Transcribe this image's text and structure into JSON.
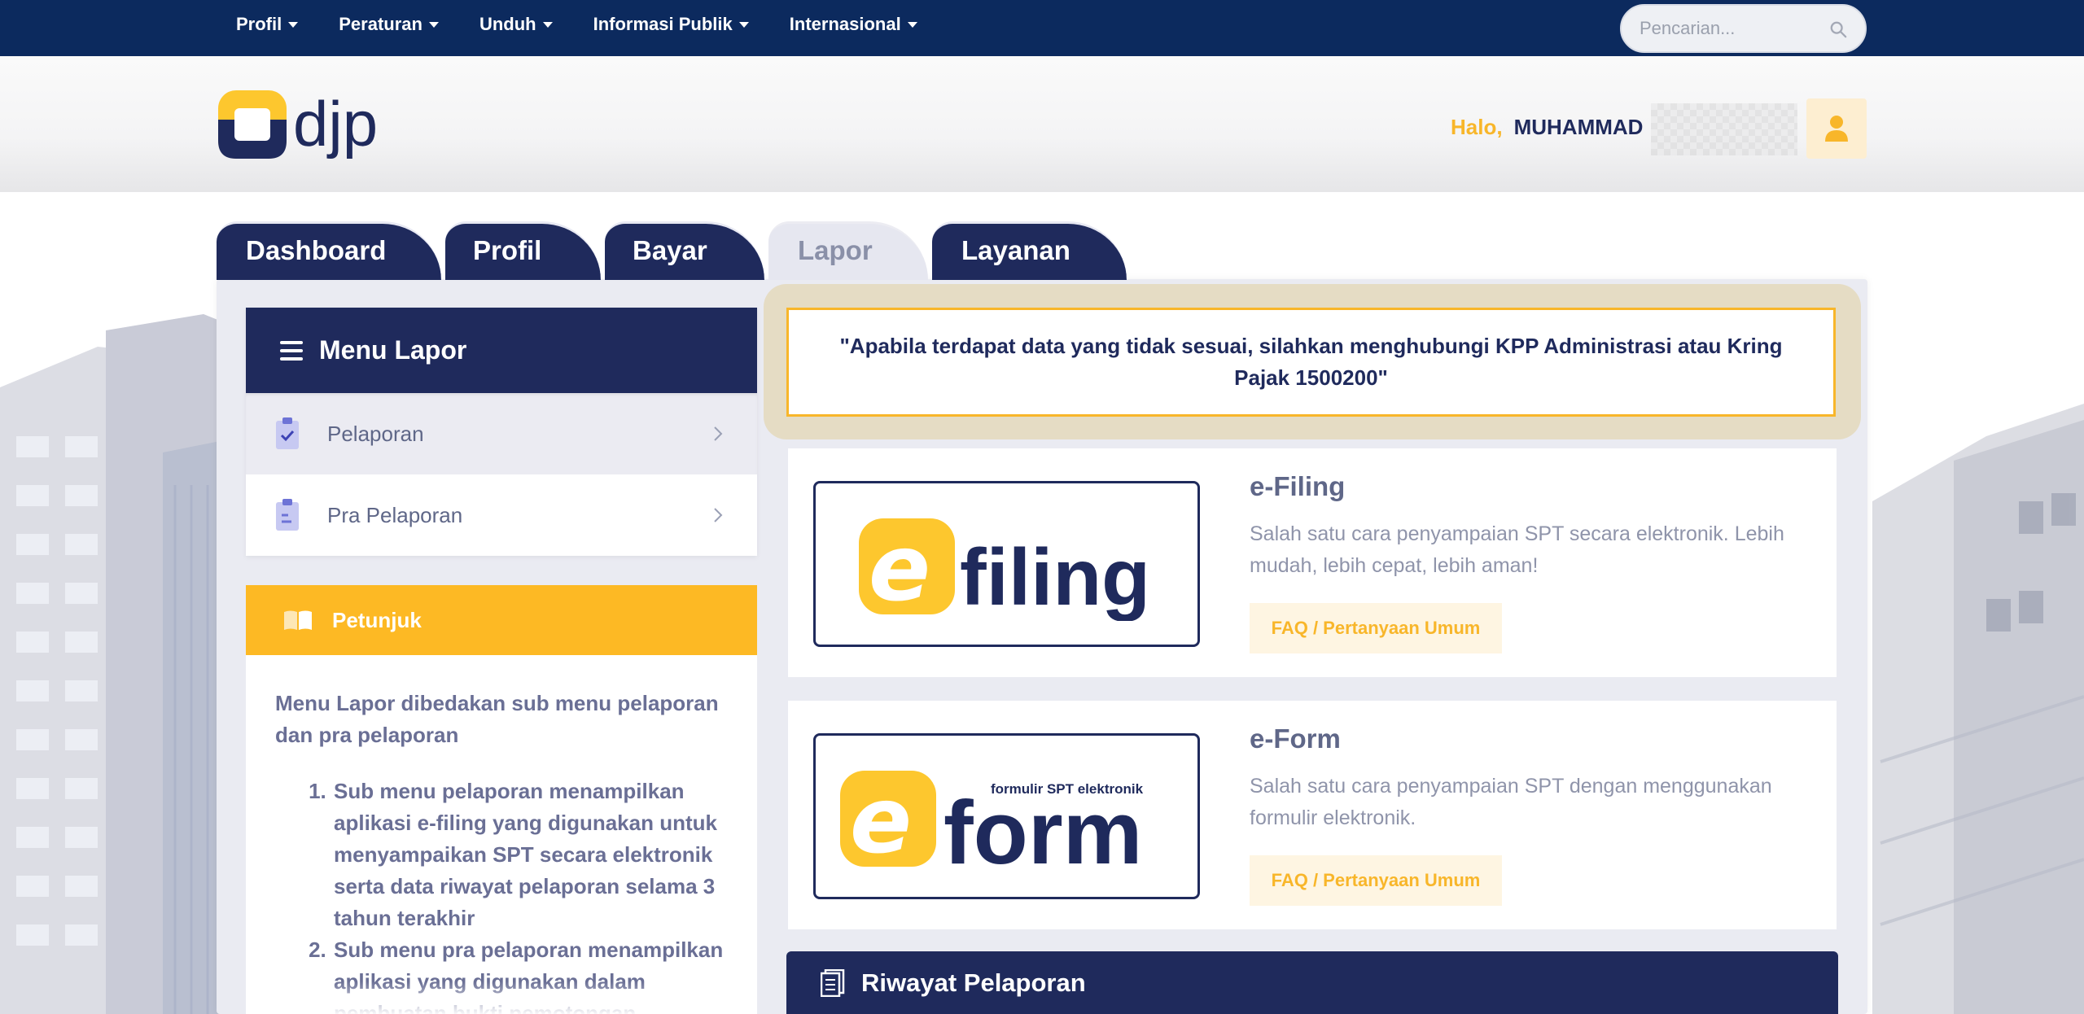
{
  "nav": {
    "items": [
      {
        "label": "Profil"
      },
      {
        "label": "Peraturan"
      },
      {
        "label": "Unduh"
      },
      {
        "label": "Informasi Publik"
      },
      {
        "label": "Internasional"
      }
    ],
    "search_placeholder": "Pencarian..."
  },
  "header": {
    "greeting": "Halo,",
    "user_name": "MUHAMMAD"
  },
  "tabs": [
    {
      "label": "Dashboard",
      "active": false
    },
    {
      "label": "Profil",
      "active": false
    },
    {
      "label": "Bayar",
      "active": false
    },
    {
      "label": "Lapor",
      "active": true
    },
    {
      "label": "Layanan",
      "active": false
    }
  ],
  "menu": {
    "title": "Menu Lapor",
    "items": [
      {
        "label": "Pelaporan",
        "active": true
      },
      {
        "label": "Pra Pelaporan",
        "active": false
      }
    ]
  },
  "petunjuk": {
    "title": "Petunjuk",
    "intro": "Menu Lapor dibedakan sub menu pelaporan dan pra pelaporan",
    "steps": [
      "Sub menu pelaporan menampilkan aplikasi e-filing yang digunakan untuk menyampaikan SPT secara elektronik serta data riwayat pelaporan selama 3 tahun terakhir",
      "Sub menu pra pelaporan menampilkan aplikasi yang digunakan dalam pembuatan bukti pemotongan"
    ]
  },
  "notice": "\"Apabila terdapat data yang tidak sesuai, silahkan menghubungi KPP Administrasi atau Kring Pajak 1500200\"",
  "apps": [
    {
      "title": "e-Filing",
      "description": "Salah satu cara penyampaian SPT secara elektronik. Lebih mudah, lebih cepat, lebih aman!",
      "faq_label": "FAQ / Pertanyaan Umum",
      "logo_text": "filing"
    },
    {
      "title": "e-Form",
      "description": "Salah satu cara penyampaian SPT dengan menggunakan formulir elektronik.",
      "faq_label": "FAQ / Pertanyaan Umum",
      "logo_text": "form",
      "logo_subtext": "formulir SPT elektronik"
    }
  ],
  "riwayat_title": "Riwayat Pelaporan",
  "logo_text": "djp",
  "colors": {
    "navy": "#1f2a5c",
    "topbar": "#0c2a5e",
    "accent_yellow": "#f8b62a",
    "panel_bg": "#eaebf2"
  }
}
